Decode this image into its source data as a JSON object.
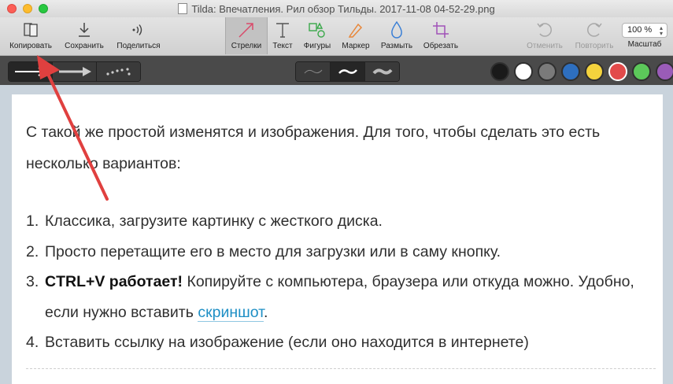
{
  "window": {
    "title": "Tilda: Впечатления. Рил обзор Тильды. 2017-11-08 04-52-29.png"
  },
  "toolbar": {
    "copy": "Копировать",
    "save": "Сохранить",
    "share": "Поделиться",
    "arrows": "Стрелки",
    "text": "Текст",
    "shapes": "Фигуры",
    "marker": "Маркер",
    "blur": "Размыть",
    "crop": "Обрезать",
    "undo": "Отменить",
    "redo": "Повторить",
    "zoom_value": "100 %",
    "zoom_label": "Масштаб"
  },
  "colors": {
    "swatches": [
      "#1a1a1a",
      "#ffffff",
      "#7a7a7a",
      "#2e6fbf",
      "#f4d33d",
      "#e24a4a",
      "#5cc85a",
      "#9a5cb8"
    ],
    "selected_index": 5,
    "accent": "#e0403f"
  },
  "document": {
    "paragraph": "С такой же простой изменятся и изображения. Для того, чтобы сделать это есть несколько вариантов:",
    "items": [
      {
        "num": "1.",
        "text": "Классика, загрузите картинку с жесткого диска."
      },
      {
        "num": "2.",
        "text": "Просто перетащите его в место для загрузки или в саму кнопку."
      },
      {
        "num": "3.",
        "bold": "CTRL+V работает!",
        "text": " Копируйте с компьютера, браузера или откуда можно. Удобно, если нужно вставить ",
        "link": "скриншот",
        "tail": "."
      },
      {
        "num": "4.",
        "text": "Вставить ссылку на изображение (если оно находится в интернете)"
      }
    ]
  }
}
